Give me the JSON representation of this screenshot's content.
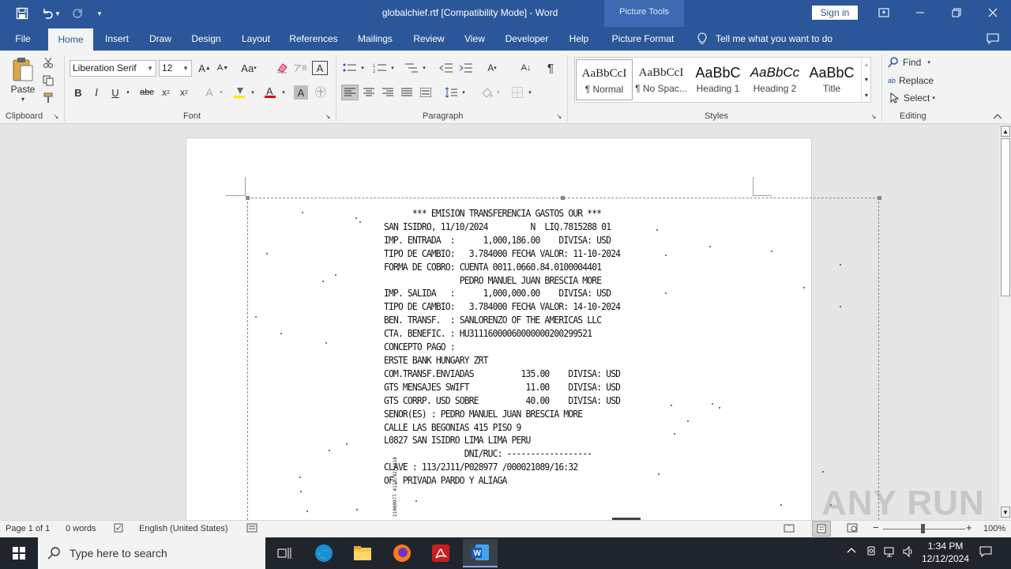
{
  "titlebar": {
    "title": "globalchief.rtf [Compatibility Mode]  -  Word",
    "picture_tools": "Picture Tools",
    "sign_in": "Sign in"
  },
  "tabs": [
    "File",
    "Home",
    "Insert",
    "Draw",
    "Design",
    "Layout",
    "References",
    "Mailings",
    "Review",
    "View",
    "Developer",
    "Help",
    "Picture Format"
  ],
  "tell_me": "Tell me what you want to do",
  "clipboard": {
    "paste": "Paste",
    "label": "Clipboard"
  },
  "font": {
    "family": "Liberation Serif",
    "size": "12",
    "label": "Font"
  },
  "paragraph": {
    "label": "Paragraph"
  },
  "styles": {
    "label": "Styles",
    "items": [
      {
        "preview": "AaBbCcI",
        "name": "¶ Normal"
      },
      {
        "preview": "AaBbCcI",
        "name": "¶ No Spac..."
      },
      {
        "preview": "AaBbC",
        "name": "Heading 1"
      },
      {
        "preview": "AaBbCc",
        "name": "Heading 2"
      },
      {
        "preview": "AaBbC",
        "name": "Title"
      }
    ]
  },
  "editing": {
    "find": "Find",
    "replace": "Replace",
    "select": "Select",
    "label": "Editing"
  },
  "scan_lines": [
    "      *** EMISION TRANSFERENCIA GASTOS OUR ***",
    "SAN ISIDRO, 11/10/2024         N  LIQ.7815288 01",
    "IMP. ENTRADA  :      1,000,186.00    DIVISA: USD",
    "TIPO DE CAMBIO:   3.784000 FECHA VALOR: 11-10-2024",
    "FORMA DE COBRO: CUENTA 0011.0660.84.0100004401",
    "                PEDRO MANUEL JUAN BRESCIA MORE",
    "IMP. SALIDA   :      1,000,000.00    DIVISA: USD",
    "TIPO DE CAMBIO:   3.784000 FECHA VALOR: 14-10-2024",
    "BEN. TRANSF.  : SANLORENZO OF THE AMERICAS LLC",
    "CTA. BENEFIC. : HU31116000060000000200299521",
    "CONCEPTO PAGO :",
    "ERSTE BANK HUNGARY ZRT",
    "COM.TRANSF.ENVIADAS          135.00    DIVISA: USD",
    "GTS MENSAJES SWIFT            11.00    DIVISA: USD",
    "GTS CORRP. USD SOBRE          40.00    DIVISA: USD",
    "SENOR(ES) : PEDRO MANUEL JUAN BRESCIA MORE",
    "CALLE LAS BEGONIAS 415 PISO 9",
    "L0827 SAN ISIDRO LIMA LIMA PERU",
    "                 DNI/RUC: ------------------",
    "CLAVE : 113/2J11/P028977 /000021089/16:32",
    "OF. PRIVADA PARDO Y ALIAGA"
  ],
  "scan_side_text": "21000977 4110/02/1018",
  "status": {
    "page": "Page 1 of 1",
    "words": "0 words",
    "language": "English (United States)",
    "zoom": "100%"
  },
  "taskbar": {
    "search": "Type here to search",
    "time": "1:34 PM",
    "date": "12/12/2024"
  },
  "watermark": "ANY RUN"
}
